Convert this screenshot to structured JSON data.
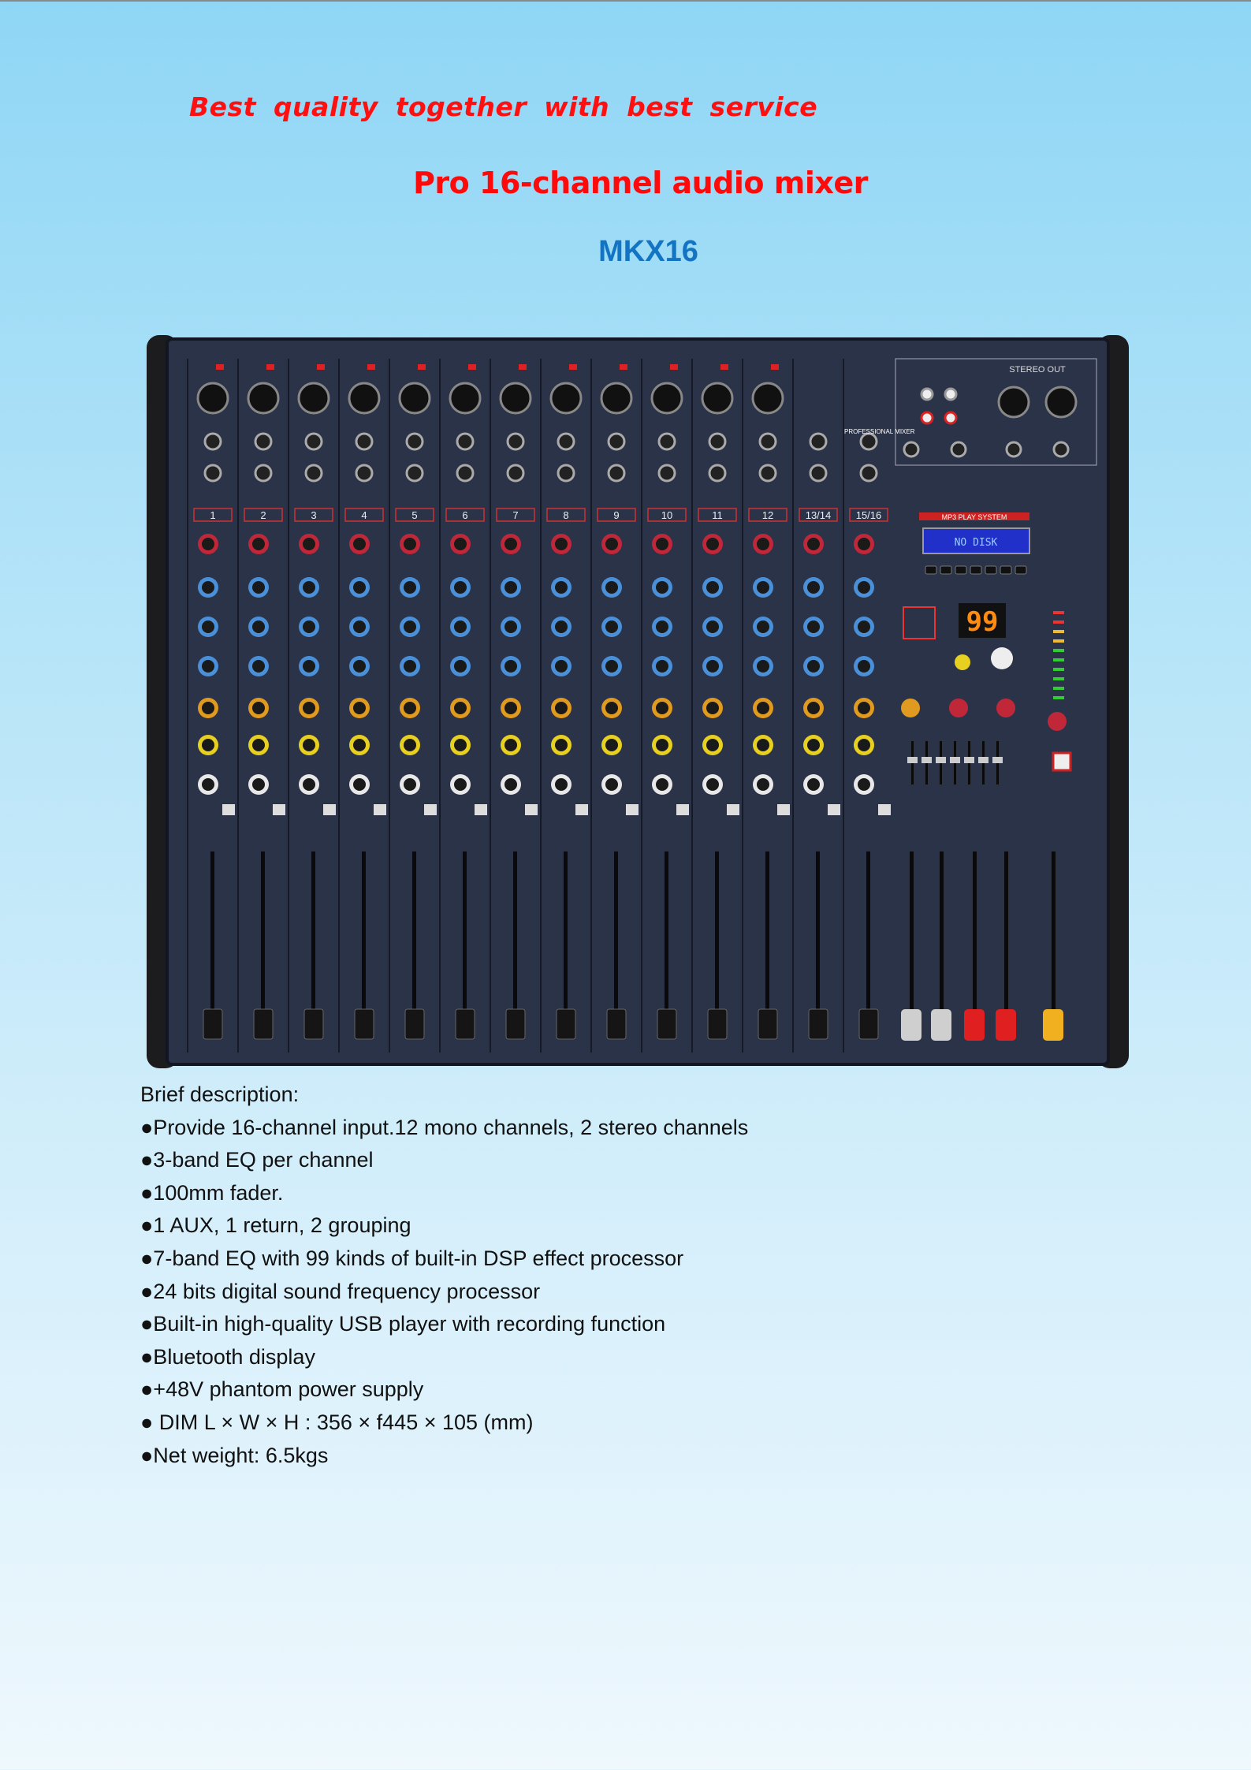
{
  "header": {
    "tagline": "Best  quality  together  with  best  service",
    "title": "Pro 16-channel audio mixer",
    "model": "MKX16"
  },
  "mixer": {
    "channel_labels": [
      "1",
      "2",
      "3",
      "4",
      "5",
      "6",
      "7",
      "8",
      "9",
      "10",
      "11",
      "12",
      "13/14",
      "15/16"
    ],
    "lcd_text": "NO DISK",
    "dsp_display": "99",
    "mp3_label": "MP3 PLAY SYSTEM",
    "stereo_out_label": "STEREO OUT",
    "brand_label": "PROFESSIONAL MIXER",
    "fader_cap_colors": [
      "#cfcfcf",
      "#cfcfcf",
      "#e02020",
      "#e02020",
      "#f0b020"
    ],
    "knob_colors": {
      "gain": "#c0283a",
      "eq": "#4a90d8",
      "aux": "#e09a20",
      "fx": "#e8d020",
      "pan": "#e8e8e8"
    },
    "panel_color": "#2b3349"
  },
  "description": {
    "heading": "Brief description:",
    "items": [
      "●Provide 16-channel input.12 mono channels, 2 stereo channels",
      "●3-band EQ per channel",
      "●100mm fader.",
      "●1 AUX, 1 return, 2 grouping",
      "●7-band EQ with 99 kinds of built-in DSP effect processor",
      "●24 bits digital sound frequency processor",
      "●Built-in high-quality USB player with recording function",
      "●Bluetooth display",
      "●+48V phantom power supply",
      "● DIM L × W × H : 356 × f445 × 105 (mm)",
      "●Net weight: 6.5kgs"
    ]
  }
}
